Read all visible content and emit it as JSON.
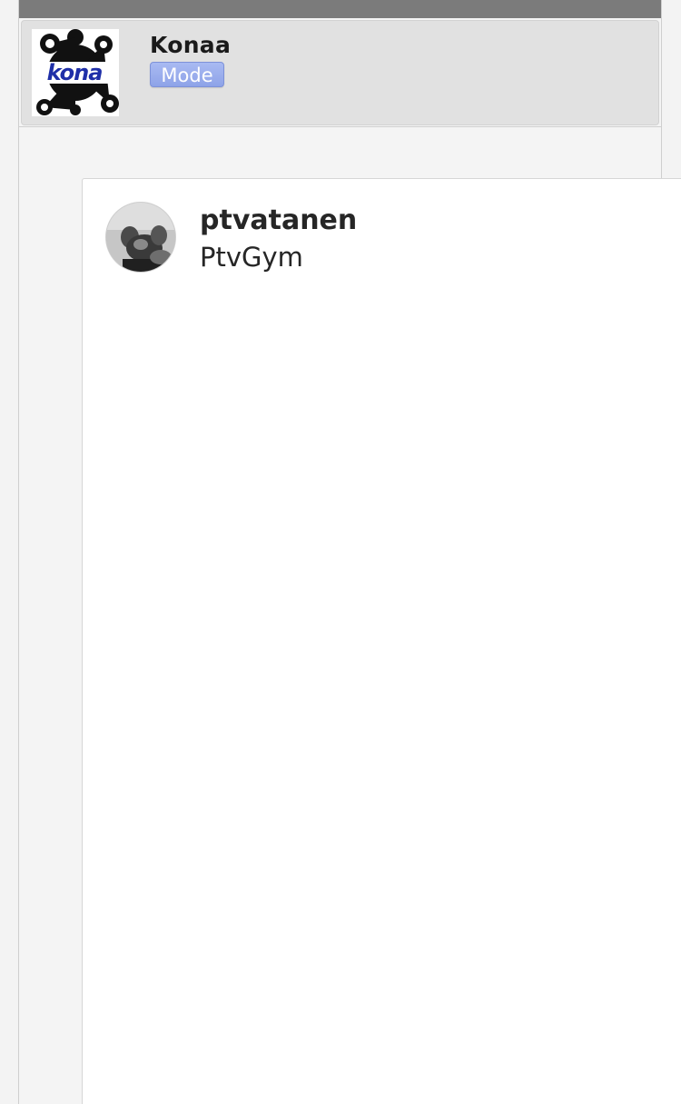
{
  "header": {
    "brand_name": "Konaa",
    "mode_button_label": "Mode",
    "logo_icon": "kona-splat-logo"
  },
  "profile": {
    "username": "ptvatanen",
    "full_name": "PtvGym",
    "avatar_icon": "profile-photo-avatar"
  },
  "colors": {
    "top_bar": "#7b7b7b",
    "header_card": "#e1e1e1",
    "mode_button": "#9aaeef",
    "logo_blue": "#1f2fa8"
  }
}
